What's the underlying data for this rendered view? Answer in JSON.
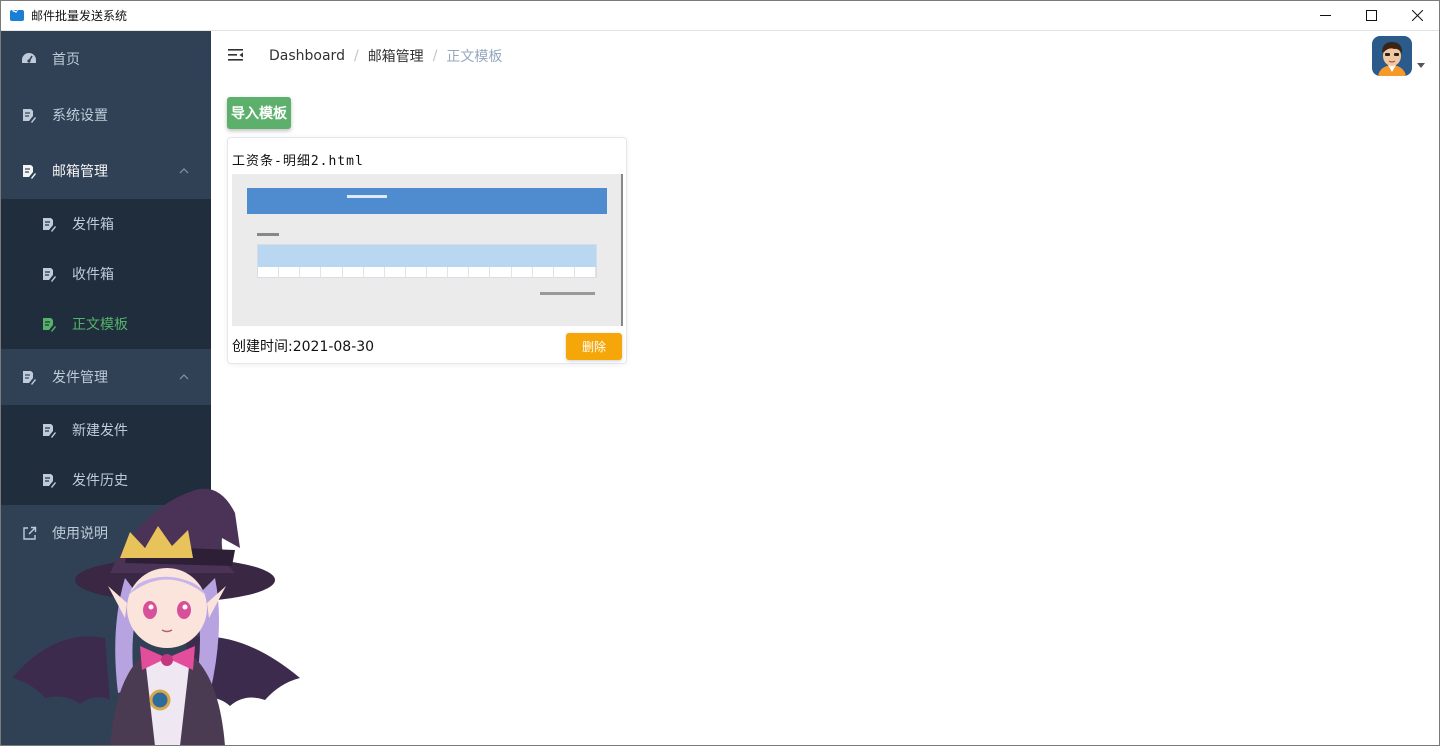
{
  "window": {
    "title": "邮件批量发送系统",
    "controls": [
      "minimize-icon",
      "maximize-icon",
      "close-icon"
    ]
  },
  "sidebar": {
    "background": "#304156",
    "submenu_background": "#1f2d3d",
    "active_color": "#55b26a",
    "items": [
      {
        "label": "首页",
        "icon": "dashboard-icon"
      },
      {
        "label": "系统设置",
        "icon": "document-edit-icon"
      },
      {
        "label": "邮箱管理",
        "icon": "document-edit-icon",
        "expanded": true,
        "children": [
          {
            "label": "发件箱",
            "icon": "document-edit-icon"
          },
          {
            "label": "收件箱",
            "icon": "document-edit-icon"
          },
          {
            "label": "正文模板",
            "icon": "document-edit-icon",
            "active": true
          }
        ]
      },
      {
        "label": "发件管理",
        "icon": "document-edit-icon",
        "expanded": true,
        "children": [
          {
            "label": "新建发件",
            "icon": "document-edit-icon"
          },
          {
            "label": "发件历史",
            "icon": "document-edit-icon"
          }
        ]
      },
      {
        "label": "使用说明",
        "icon": "external-link-icon"
      }
    ]
  },
  "navbar": {
    "breadcrumb": [
      "Dashboard",
      "邮箱管理",
      "正文模板"
    ]
  },
  "main": {
    "import_button": "导入模板",
    "import_color": "#5daf6c",
    "cards": [
      {
        "title": "工资条-明细2.html",
        "created": "创建时间:2021-08-30",
        "delete_label": "删除",
        "delete_color": "#f5a70a"
      }
    ]
  }
}
